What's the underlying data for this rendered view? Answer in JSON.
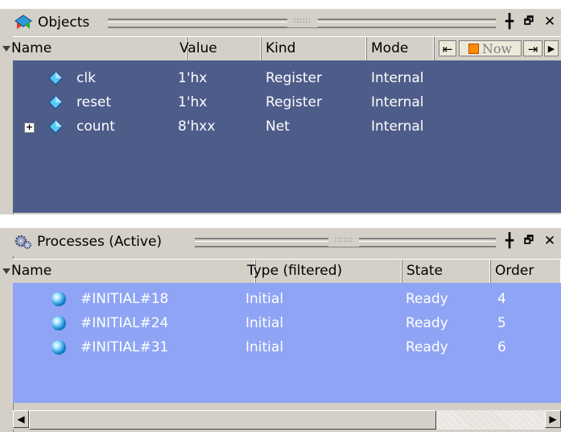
{
  "objects": {
    "title": "Objects",
    "icon": "objects-icon",
    "buttons": {
      "dock": "╋",
      "undock": "🗗",
      "close": "✕"
    },
    "columns": [
      "Name",
      "Value",
      "Kind",
      "Mode"
    ],
    "now_label": "Now",
    "rows": [
      {
        "name": "clk",
        "value": "1'hx",
        "kind": "Register",
        "mode": "Internal",
        "expandable": false
      },
      {
        "name": "reset",
        "value": "1'hx",
        "kind": "Register",
        "mode": "Internal",
        "expandable": false
      },
      {
        "name": "count",
        "value": "8'hxx",
        "kind": "Net",
        "mode": "Internal",
        "expandable": true
      }
    ]
  },
  "processes": {
    "title": "Processes (Active)",
    "icon": "gear-icon",
    "columns": [
      "Name",
      "Type (filtered)",
      "State",
      "Order"
    ],
    "rows": [
      {
        "name": "#INITIAL#18",
        "type": "Initial",
        "state": "Ready",
        "order": "4"
      },
      {
        "name": "#INITIAL#24",
        "type": "Initial",
        "state": "Ready",
        "order": "5"
      },
      {
        "name": "#INITIAL#31",
        "type": "Initial",
        "state": "Ready",
        "order": "6"
      }
    ]
  },
  "colors": {
    "objects_bg": "#4e5c8a",
    "processes_bg": "#8fa4f4",
    "chrome": "#d4d0c8"
  }
}
